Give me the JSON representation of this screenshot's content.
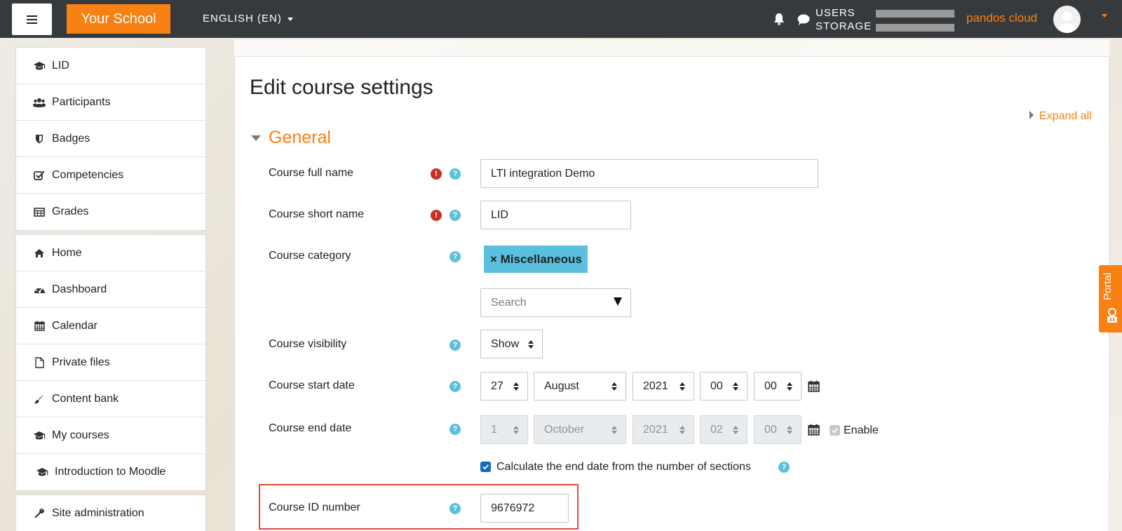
{
  "header": {
    "brand": "Your School",
    "language": "ENGLISH (EN)",
    "quota_users": "USERS",
    "quota_storage": "STORAGE",
    "username": "pandos cloud"
  },
  "sidebar": {
    "groups": [
      [
        {
          "label": "LID",
          "icon": "graduation-cap-icon"
        },
        {
          "label": "Participants",
          "icon": "users-icon"
        },
        {
          "label": "Badges",
          "icon": "shield-icon"
        },
        {
          "label": "Competencies",
          "icon": "checkbox-icon"
        },
        {
          "label": "Grades",
          "icon": "table-icon"
        }
      ],
      [
        {
          "label": "Home",
          "icon": "home-icon"
        },
        {
          "label": "Dashboard",
          "icon": "dashboard-icon"
        },
        {
          "label": "Calendar",
          "icon": "calendar-icon"
        },
        {
          "label": "Private files",
          "icon": "file-icon"
        },
        {
          "label": "Content bank",
          "icon": "brush-icon"
        },
        {
          "label": "My courses",
          "icon": "graduation-cap-icon"
        },
        {
          "label": "Introduction to Moodle",
          "icon": "graduation-cap-icon"
        }
      ],
      [
        {
          "label": "Site administration",
          "icon": "wrench-icon"
        }
      ]
    ]
  },
  "page": {
    "title": "Edit course settings",
    "expand_all": "Expand all",
    "section_title": "General"
  },
  "form": {
    "fullname_label": "Course full name",
    "fullname_value": "LTI integration Demo",
    "shortname_label": "Course short name",
    "shortname_value": "LID",
    "category_label": "Course category",
    "category_tag": "× Miscellaneous",
    "category_search_placeholder": "Search",
    "visibility_label": "Course visibility",
    "visibility_value": "Show",
    "startdate_label": "Course start date",
    "start": {
      "day": "27",
      "month": "August",
      "year": "2021",
      "hour": "00",
      "minute": "00"
    },
    "enddate_label": "Course end date",
    "end": {
      "day": "1",
      "month": "October",
      "year": "2021",
      "hour": "02",
      "minute": "00"
    },
    "end_enable_label": "Enable",
    "end_enabled": true,
    "calc_end_label": "Calculate the end date from the number of sections",
    "calc_end_checked": true,
    "idnumber_label": "Course ID number",
    "idnumber_value": "9676972"
  },
  "portal_tab": "Portal",
  "colors": {
    "accent": "#f98012",
    "help": "#5bc0de",
    "required": "#ca3120",
    "topbar": "#373a3c",
    "highlight": "#e2453c"
  }
}
